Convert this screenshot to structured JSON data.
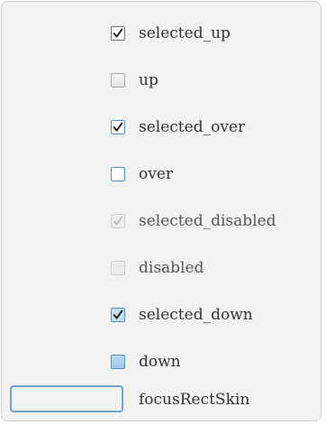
{
  "skins": [
    {
      "label": "selected_up",
      "state": "up",
      "checked": true
    },
    {
      "label": "up",
      "state": "plain",
      "checked": false
    },
    {
      "label": "selected_over",
      "state": "over",
      "checked": true
    },
    {
      "label": "over",
      "state": "over",
      "checked": false
    },
    {
      "label": "selected_disabled",
      "state": "disabled",
      "checked": true
    },
    {
      "label": "disabled",
      "state": "disabled",
      "checked": false
    },
    {
      "label": "selected_down",
      "state": "down",
      "checked": true
    },
    {
      "label": "down",
      "state": "down-plain",
      "checked": false
    }
  ],
  "focus": {
    "label": "focusRectSkin"
  },
  "colors": {
    "panel_bg": "#f2f2f0",
    "accent": "#4e8fc8",
    "check_dark": "#222222",
    "check_disabled": "#b5b5b5",
    "text": "#333333"
  }
}
